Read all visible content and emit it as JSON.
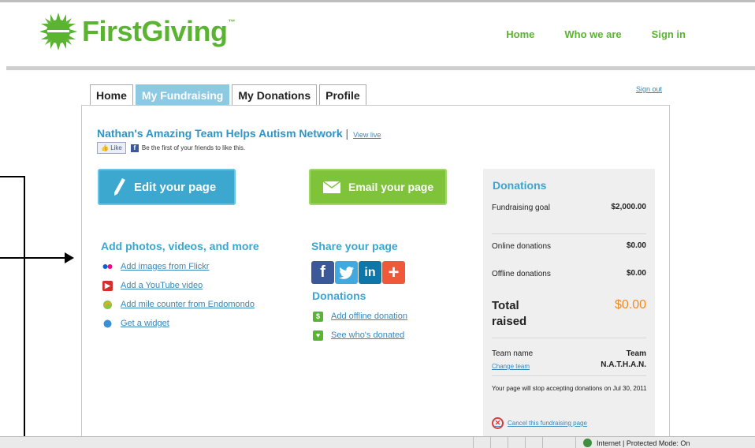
{
  "header": {
    "logo_text": "FirstGiving",
    "logo_tm": "™",
    "nav": [
      "Home",
      "Who we are",
      "Sign in"
    ]
  },
  "tabs": [
    {
      "label": "Home",
      "active": false
    },
    {
      "label": "My Fundraising",
      "active": true
    },
    {
      "label": "My Donations",
      "active": false
    },
    {
      "label": "Profile",
      "active": false
    }
  ],
  "sign_out": "Sign out",
  "page": {
    "title": "Nathan's Amazing Team Helps Autism Network",
    "separator": "|",
    "view_live": "View live",
    "like_button": "Like",
    "like_text": "Be the first of your friends to like this."
  },
  "buttons": {
    "edit": "Edit your page",
    "email": "Email your page"
  },
  "add_section": {
    "heading": "Add photos, videos, and more",
    "links": [
      {
        "icon": "flickr-icon",
        "label": "Add images from Flickr"
      },
      {
        "icon": "youtube-icon",
        "label": "Add a YouTube video"
      },
      {
        "icon": "endomondo-icon",
        "label": "Add mile counter from Endomondo"
      },
      {
        "icon": "widget-icon",
        "label": "Get a widget"
      }
    ]
  },
  "share_section": {
    "heading": "Share your page",
    "icons": [
      "facebook-icon",
      "twitter-icon",
      "linkedin-icon",
      "addthis-icon"
    ],
    "donations_heading": "Donations",
    "links": [
      {
        "icon": "offline-donation-icon",
        "label": "Add offline donation"
      },
      {
        "icon": "heart-icon",
        "label": "See who's donated"
      }
    ]
  },
  "donations_box": {
    "heading": "Donations",
    "fundraising_goal_label": "Fundraising goal",
    "fundraising_goal_value": "$2,000.00",
    "online_label": "Online donations",
    "online_value": "$0.00",
    "offline_label": "Offline donations",
    "offline_value": "$0.00",
    "total_label": "Total raised",
    "total_value": "$0.00",
    "team_name_label": "Team name",
    "change_team": "Change team",
    "team_name_value": "Team N.A.T.H.A.N.",
    "stop_note": "Your page will stop accepting donations on Jul 30, 2011",
    "cancel": "Cancel this fundraising page"
  },
  "statusbar": {
    "zone": "Internet | Protected Mode: On"
  },
  "colors": {
    "brand_green": "#5bb431",
    "accent_blue": "#3aa6cf",
    "tab_active": "#8cc9e2",
    "total_orange": "#f08a24"
  }
}
